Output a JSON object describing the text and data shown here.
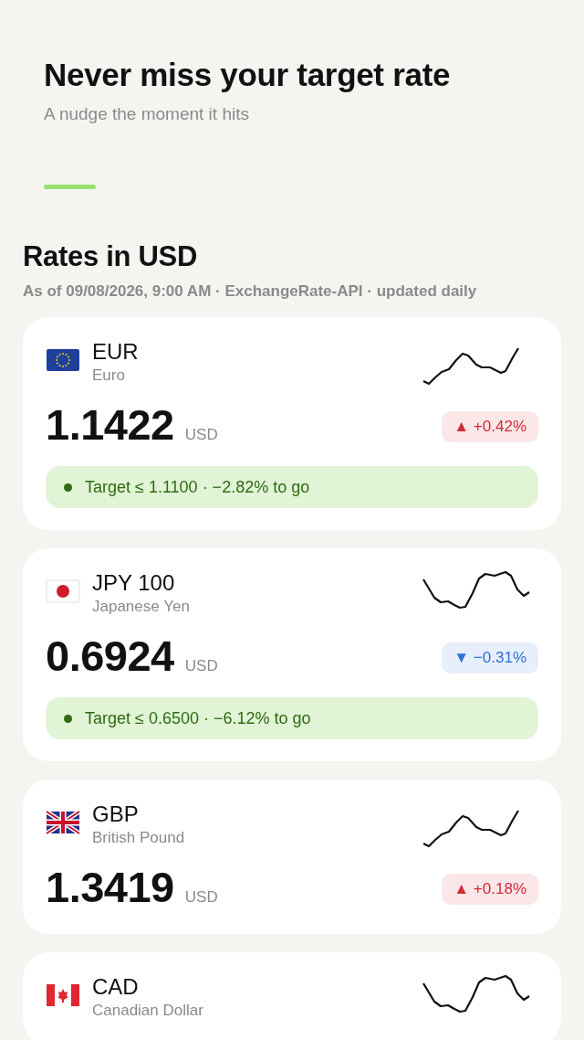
{
  "hero": {
    "title": "Never miss your target rate",
    "subtitle": "A nudge the moment it hits"
  },
  "section": {
    "title": "Rates in USD",
    "meta": "As of 09/08/2026, 9:00 AM · ExchangeRate-API · updated daily"
  },
  "rates": [
    {
      "flag": {
        "kind": "eu"
      },
      "code": "EUR",
      "name": "Euro",
      "sparkline": {
        "kind": "rise"
      },
      "price": "1.1422",
      "unit": "USD",
      "change": {
        "kind": "up",
        "text": "▲ +0.42%"
      },
      "target": "Target ≤ 1.1100 · −2.82% to go"
    },
    {
      "flag": {
        "kind": "jp"
      },
      "code": "JPY 100",
      "name": "Japanese Yen",
      "sparkline": {
        "kind": "dip"
      },
      "price": "0.6924",
      "unit": "USD",
      "change": {
        "kind": "down",
        "text": "▼ −0.31%"
      },
      "target": "Target ≤ 0.6500 · −6.12% to go"
    },
    {
      "flag": {
        "kind": "gb"
      },
      "code": "GBP",
      "name": "British Pound",
      "sparkline": {
        "kind": "rise"
      },
      "price": "1.3419",
      "unit": "USD",
      "change": {
        "kind": "up",
        "text": "▲ +0.18%"
      }
    },
    {
      "flag": {
        "kind": "ca"
      },
      "code": "CAD",
      "name": "Canadian Dollar",
      "sparkline": {
        "kind": "dip"
      }
    }
  ]
}
